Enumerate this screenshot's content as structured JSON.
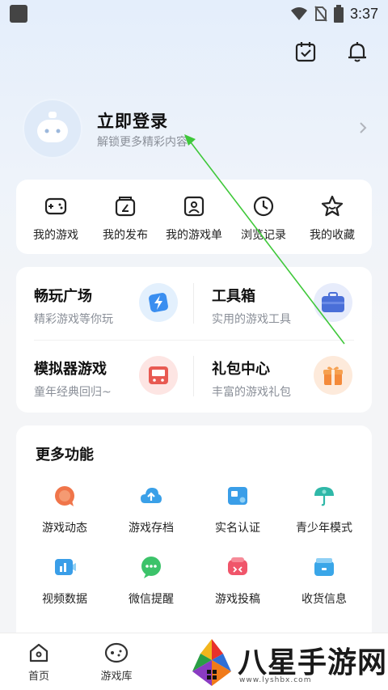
{
  "status_bar": {
    "time": "3:37"
  },
  "login": {
    "title": "立即登录",
    "subtitle": "解锁更多精彩内容"
  },
  "quick_links": [
    {
      "label": "我的游戏",
      "icon": "gamepad-icon"
    },
    {
      "label": "我的发布",
      "icon": "publish-icon"
    },
    {
      "label": "我的游戏单",
      "icon": "game-list-icon"
    },
    {
      "label": "浏览记录",
      "icon": "clock-icon"
    },
    {
      "label": "我的收藏",
      "icon": "star-icon"
    }
  ],
  "features": [
    {
      "title": "畅玩广场",
      "subtitle": "精彩游戏等你玩",
      "icon": "lightning-icon",
      "color": "#3a8ef0"
    },
    {
      "title": "工具箱",
      "subtitle": "实用的游戏工具",
      "icon": "toolbox-icon",
      "color": "#4a6fd8"
    },
    {
      "title": "模拟器游戏",
      "subtitle": "童年经典回归~",
      "icon": "emulator-icon",
      "color": "#e85a52"
    },
    {
      "title": "礼包中心",
      "subtitle": "丰富的游戏礼包",
      "icon": "gift-icon",
      "color": "#f48a3a"
    }
  ],
  "more": {
    "title": "更多功能",
    "items": [
      {
        "label": "游戏动态",
        "icon": "news-icon",
        "color": "#f0754a"
      },
      {
        "label": "游戏存档",
        "icon": "cloud-upload-icon",
        "color": "#3aa0e8"
      },
      {
        "label": "实名认证",
        "icon": "id-card-icon",
        "color": "#3a9ee8"
      },
      {
        "label": "青少年模式",
        "icon": "umbrella-icon",
        "color": "#2fb8a8"
      },
      {
        "label": "视频数据",
        "icon": "video-stats-icon",
        "color": "#3a9ee8"
      },
      {
        "label": "微信提醒",
        "icon": "wechat-icon",
        "color": "#3cc36a"
      },
      {
        "label": "游戏投稿",
        "icon": "submit-icon",
        "color": "#f0556a"
      },
      {
        "label": "收货信息",
        "icon": "address-icon",
        "color": "#3aa6e8"
      }
    ]
  },
  "bottom_nav": [
    {
      "label": "首页",
      "icon": "home-icon"
    },
    {
      "label": "游戏库",
      "icon": "game-library-icon"
    }
  ],
  "watermark": {
    "text": "八星手游网",
    "url": "www.lyshbx.com"
  }
}
